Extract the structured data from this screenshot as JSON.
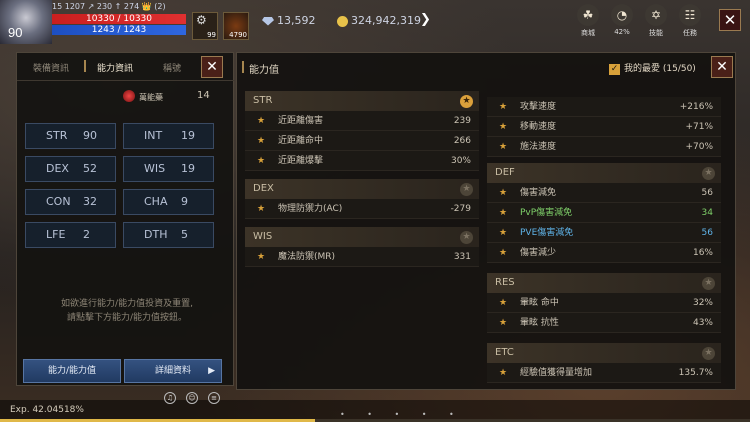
{
  "hud": {
    "level": "90",
    "stats_line": "15 1207 ↗ 230 ↑ 274 👑 (2)",
    "hp": "10330 / 10330",
    "mp": "1243 / 1243",
    "slot1_count": "99",
    "slot2_count": "4790",
    "diamonds": "13,592",
    "gold": "324,942,319",
    "menu": [
      {
        "label": "商城",
        "icon": "☘"
      },
      {
        "label": "42%",
        "icon": "◔"
      },
      {
        "label": "技能",
        "icon": "✡"
      },
      {
        "label": "任務",
        "icon": "☷"
      }
    ],
    "close": "✕"
  },
  "left_panel": {
    "tabs": [
      "裝備資訊",
      "能力資訊",
      "稱號"
    ],
    "close": "✕",
    "potion_label": "萬能藥",
    "potion_count": "14",
    "stats": [
      {
        "key": "STR",
        "value": "90"
      },
      {
        "key": "INT",
        "value": "19"
      },
      {
        "key": "DEX",
        "value": "52"
      },
      {
        "key": "WIS",
        "value": "19"
      },
      {
        "key": "CON",
        "value": "32"
      },
      {
        "key": "CHA",
        "value": "9"
      },
      {
        "key": "LFE",
        "value": "2"
      },
      {
        "key": "DTH",
        "value": "5"
      }
    ],
    "info_line1": "如欲進行能力/能力值投資及重置,",
    "info_line2": "請點擊下方能力/能力值按鈕。",
    "button_ability": "能力/能力值",
    "button_detail": "詳細資料"
  },
  "right_panel": {
    "title": "能力值",
    "favorite_label": "我的最愛 (15/50)",
    "close": "✕",
    "left_sections": [
      {
        "name": "STR",
        "starred": true,
        "rows": [
          {
            "label": "近距離傷害",
            "value": "239"
          },
          {
            "label": "近距離命中",
            "value": "266"
          },
          {
            "label": "近距離爆擊",
            "value": "30%"
          }
        ]
      },
      {
        "name": "DEX",
        "starred": false,
        "rows": [
          {
            "label": "物理防禦力(AC)",
            "value": "-279"
          }
        ]
      },
      {
        "name": "WIS",
        "starred": false,
        "rows": [
          {
            "label": "魔法防禦(MR)",
            "value": "331"
          }
        ]
      }
    ],
    "right_top_rows": [
      {
        "label": "攻擊速度",
        "value": "+216%"
      },
      {
        "label": "移動速度",
        "value": "+71%"
      },
      {
        "label": "施法速度",
        "value": "+70%"
      }
    ],
    "right_sections": [
      {
        "name": "DEF",
        "starred": false,
        "rows": [
          {
            "label": "傷害減免",
            "value": "56",
            "tone": ""
          },
          {
            "label": "PvP傷害減免",
            "value": "34",
            "tone": "green"
          },
          {
            "label": "PVE傷害減免",
            "value": "56",
            "tone": "blue"
          },
          {
            "label": "傷害減少",
            "value": "16%",
            "tone": ""
          }
        ]
      },
      {
        "name": "RES",
        "starred": false,
        "rows": [
          {
            "label": "暈眩 命中",
            "value": "32%",
            "tone": ""
          },
          {
            "label": "暈眩 抗性",
            "value": "43%",
            "tone": ""
          }
        ]
      },
      {
        "name": "ETC",
        "starred": false,
        "rows": [
          {
            "label": "經驗值獲得量增加",
            "value": "135.7%",
            "tone": ""
          }
        ]
      }
    ]
  },
  "bottom": {
    "exp": "Exp. 42.04518%",
    "exp_fraction": 0.42
  },
  "colors": {
    "accent_gold": "#d8a13a",
    "button_blue": "#2c4a76",
    "close_red": "#4a2018",
    "pvp_green": "#7fd16a",
    "pve_blue": "#5fb3e8"
  }
}
